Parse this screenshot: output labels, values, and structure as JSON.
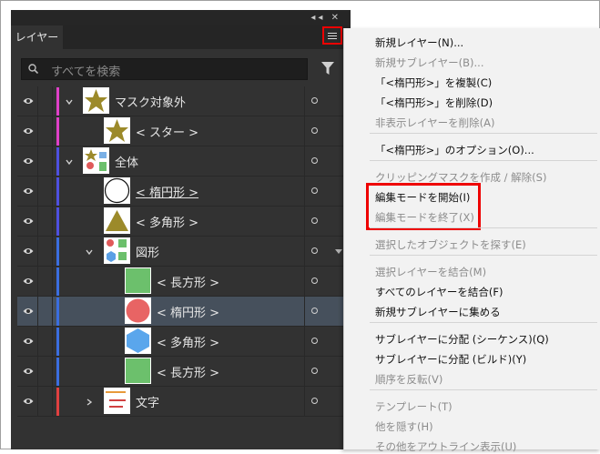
{
  "panel": {
    "tab_label": "レイヤー",
    "search_placeholder": "すべてを検索"
  },
  "layers": [
    {
      "label": "マスク対象外",
      "color": "#e040c8",
      "thumb": "star",
      "indent": 0,
      "expanded": true
    },
    {
      "label": "< スター >",
      "color": "#e040c8",
      "thumb": "star",
      "indent": 1
    },
    {
      "label": "全体",
      "color": "#4e50e0",
      "thumb": "group",
      "indent": 0,
      "expanded": true
    },
    {
      "label": "< 楕円形 >",
      "color": "#4e50e0",
      "thumb": "ellipse-outline",
      "indent": 1,
      "underline": true
    },
    {
      "label": "< 多角形 >",
      "color": "#4e50e0",
      "thumb": "triangle",
      "indent": 1
    },
    {
      "label": "図形",
      "color": "#3b6ee0",
      "thumb": "shapes",
      "indent": 1,
      "expanded": true
    },
    {
      "label": "< 長方形 >",
      "color": "#3b6ee0",
      "thumb": "green-rect",
      "indent": 2
    },
    {
      "label": "< 楕円形 >",
      "color": "#3b6ee0",
      "thumb": "red-circle",
      "indent": 2,
      "selected": true
    },
    {
      "label": "< 多角形 >",
      "color": "#3b6ee0",
      "thumb": "blue-hex",
      "indent": 2
    },
    {
      "label": "< 長方形 >",
      "color": "#3b6ee0",
      "thumb": "green-rect",
      "indent": 2
    },
    {
      "label": "文字",
      "color": "#e04040",
      "thumb": "text",
      "indent": 1,
      "expanded": false
    }
  ],
  "menu": [
    {
      "label": "新規レイヤー(N)...",
      "disabled": false
    },
    {
      "label": "新規サブレイヤー(B)...",
      "disabled": true
    },
    {
      "label": "「<楕円形>」を複製(C)",
      "disabled": false
    },
    {
      "label": "「<楕円形>」を削除(D)",
      "disabled": false
    },
    {
      "label": "非表示レイヤーを削除(A)",
      "disabled": true,
      "sep_after": true
    },
    {
      "label": "「<楕円形>」のオプション(O)...",
      "disabled": false,
      "sep_after": true
    },
    {
      "label": "クリッピングマスクを作成 / 解除(S)",
      "disabled": true
    },
    {
      "label": "編集モードを開始(I)",
      "disabled": false
    },
    {
      "label": "編集モードを終了(X)",
      "disabled": true,
      "sep_after": true
    },
    {
      "label": "選択したオブジェクトを探す(E)",
      "disabled": true,
      "sep_after": true
    },
    {
      "label": "選択レイヤーを結合(M)",
      "disabled": true
    },
    {
      "label": "すべてのレイヤーを結合(F)",
      "disabled": false
    },
    {
      "label": "新規サブレイヤーに集める",
      "disabled": false,
      "sep_after": true
    },
    {
      "label": "サブレイヤーに分配 (シーケンス)(Q)",
      "disabled": false
    },
    {
      "label": "サブレイヤーに分配 (ビルド)(Y)",
      "disabled": false
    },
    {
      "label": "順序を反転(V)",
      "disabled": true,
      "sep_after": true
    },
    {
      "label": "テンプレート(T)",
      "disabled": true
    },
    {
      "label": "他を隠す(H)",
      "disabled": true
    },
    {
      "label": "その他をアウトライン表示(U)",
      "disabled": true
    }
  ],
  "colors": {
    "highlight": "#ee0000",
    "selected_row": "#46505c"
  }
}
